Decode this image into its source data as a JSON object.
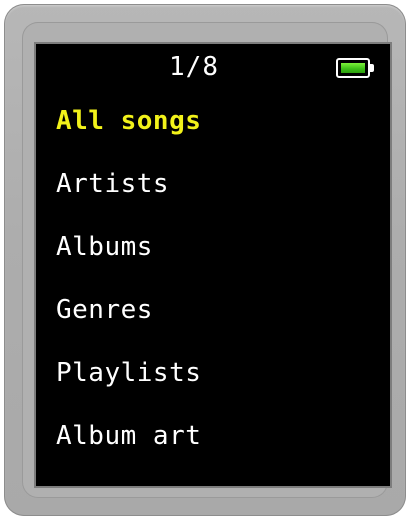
{
  "status": {
    "page_indicator": "1/8",
    "battery_icon": "battery-icon",
    "battery_level": 1.0,
    "battery_color": "#3bbf16"
  },
  "menu": {
    "selected_color": "#f2f21a",
    "text_color": "#ffffff",
    "items": [
      {
        "label": "All songs",
        "selected": true
      },
      {
        "label": "Artists",
        "selected": false
      },
      {
        "label": "Albums",
        "selected": false
      },
      {
        "label": "Genres",
        "selected": false
      },
      {
        "label": "Playlists",
        "selected": false
      },
      {
        "label": "Album art",
        "selected": false
      }
    ]
  }
}
